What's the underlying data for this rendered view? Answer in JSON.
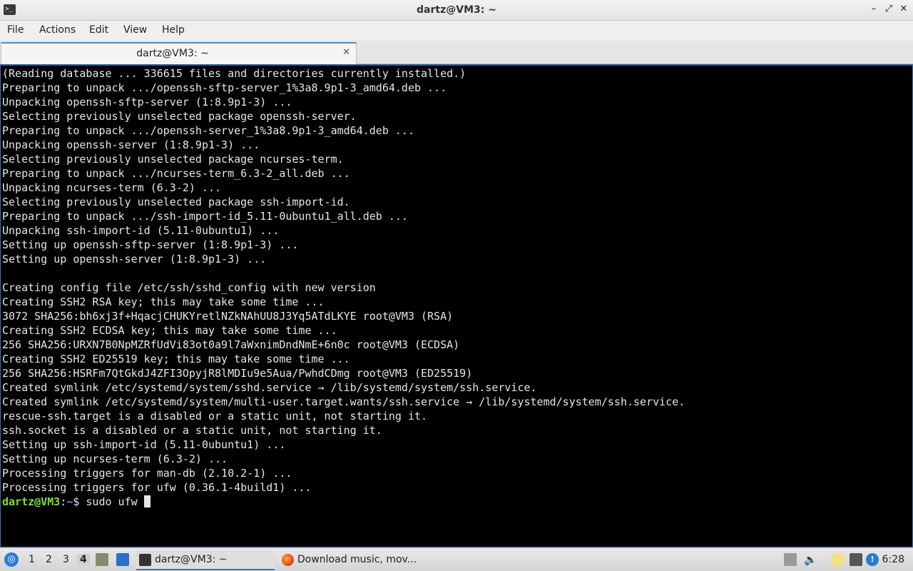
{
  "window": {
    "title": "dartz@VM3: ~",
    "controls": {
      "minimize": "–",
      "maximize": "⤢",
      "close": "✕"
    }
  },
  "menu": [
    "File",
    "Actions",
    "Edit",
    "View",
    "Help"
  ],
  "tabs": [
    {
      "label": "dartz@VM3: ~",
      "close": "✕"
    }
  ],
  "terminal": {
    "lines": [
      "(Reading database ... 336615 files and directories currently installed.)",
      "Preparing to unpack .../openssh-sftp-server_1%3a8.9p1-3_amd64.deb ...",
      "Unpacking openssh-sftp-server (1:8.9p1-3) ...",
      "Selecting previously unselected package openssh-server.",
      "Preparing to unpack .../openssh-server_1%3a8.9p1-3_amd64.deb ...",
      "Unpacking openssh-server (1:8.9p1-3) ...",
      "Selecting previously unselected package ncurses-term.",
      "Preparing to unpack .../ncurses-term_6.3-2_all.deb ...",
      "Unpacking ncurses-term (6.3-2) ...",
      "Selecting previously unselected package ssh-import-id.",
      "Preparing to unpack .../ssh-import-id_5.11-0ubuntu1_all.deb ...",
      "Unpacking ssh-import-id (5.11-0ubuntu1) ...",
      "Setting up openssh-sftp-server (1:8.9p1-3) ...",
      "Setting up openssh-server (1:8.9p1-3) ...",
      "",
      "Creating config file /etc/ssh/sshd_config with new version",
      "Creating SSH2 RSA key; this may take some time ...",
      "3072 SHA256:bh6xj3f+HqacjCHUKYretlNZkNAhUU8J3Yq5ATdLKYE root@VM3 (RSA)",
      "Creating SSH2 ECDSA key; this may take some time ...",
      "256 SHA256:URXN7B0NpMZRfUdVi83ot0a9l7aWxnimDndNmE+6n0c root@VM3 (ECDSA)",
      "Creating SSH2 ED25519 key; this may take some time ...",
      "256 SHA256:HSRFm7QtGkdJ4ZFI3OpyjR8lMDIu9e5Aua/PwhdCDmg root@VM3 (ED25519)",
      "Created symlink /etc/systemd/system/sshd.service → /lib/systemd/system/ssh.service.",
      "Created symlink /etc/systemd/system/multi-user.target.wants/ssh.service → /lib/systemd/system/ssh.service.",
      "rescue-ssh.target is a disabled or a static unit, not starting it.",
      "ssh.socket is a disabled or a static unit, not starting it.",
      "Setting up ssh-import-id (5.11-0ubuntu1) ...",
      "Setting up ncurses-term (6.3-2) ...",
      "Processing triggers for man-db (2.10.2-1) ...",
      "Processing triggers for ufw (0.36.1-4build1) ..."
    ],
    "prompt": {
      "user_host": "dartz@VM3",
      "sep": ":",
      "path": "~",
      "symbol": "$",
      "command": " sudo ufw "
    },
    "colors": {
      "background": "#000000",
      "text": "#e6e6e6",
      "user": "#7ee03c",
      "path": "#6b8cff"
    }
  },
  "taskbar": {
    "workspaces": [
      "1",
      "2",
      "3",
      "4"
    ],
    "active_workspace": "4",
    "tasks": [
      {
        "label": "dartz@VM3: ~",
        "icon": "terminal-icon"
      },
      {
        "label": "Download music, mov...",
        "icon": "firefox-icon"
      }
    ],
    "clock": "6:28"
  }
}
